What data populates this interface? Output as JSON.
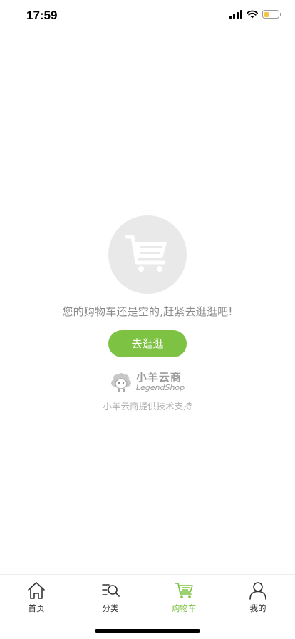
{
  "status_bar": {
    "time": "17:59"
  },
  "empty_state": {
    "message": "您的购物车还是空的,赶紧去逛逛吧!",
    "button_label": "去逛逛"
  },
  "brand": {
    "name_cn": "小羊云商",
    "name_en": "LegendShop",
    "support_text": "小羊云商提供技术支持"
  },
  "tabs": [
    {
      "label": "首页",
      "icon": "home-icon",
      "active": false
    },
    {
      "label": "分类",
      "icon": "category-search-icon",
      "active": false
    },
    {
      "label": "购物车",
      "icon": "cart-icon",
      "active": true
    },
    {
      "label": "我的",
      "icon": "user-icon",
      "active": false
    }
  ],
  "colors": {
    "accent": "#7dc242",
    "battery": "#f5c242"
  }
}
